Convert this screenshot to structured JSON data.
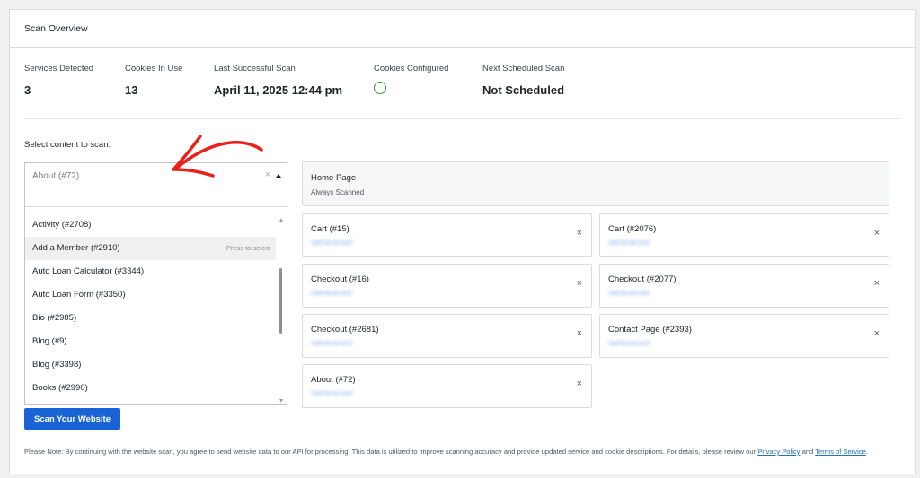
{
  "panel": {
    "title": "Scan Overview"
  },
  "stats": [
    {
      "label": "Services Detected",
      "value": "3"
    },
    {
      "label": "Cookies In Use",
      "value": "13"
    },
    {
      "label": "Last Successful Scan",
      "value": "April 11, 2025 12:44 pm"
    },
    {
      "label": "Cookies Configured",
      "icon": "check-circle-icon",
      "status_color": "#2e9e2e"
    },
    {
      "label": "Next Scheduled Scan",
      "value": "Not Scheduled"
    }
  ],
  "select": {
    "label": "Select content to scan:",
    "current_value": "About (#72)",
    "clear_symbol": "×",
    "options": [
      "Activity (#2708)",
      "Add a Member (#2910)",
      "Auto Loan Calculator (#3344)",
      "Auto Loan Form (#3350)",
      "Bio (#2985)",
      "Blog (#9)",
      "Blog (#3398)",
      "Books (#2990)"
    ],
    "highlighted_index": 1,
    "highlight_hint": "Press to select"
  },
  "annotation": {
    "icon": "red-arrow-icon",
    "color": "#e8211b"
  },
  "scan_button": {
    "label": "Scan Your Website",
    "color": "#1a63d6"
  },
  "home_page": {
    "title": "Home Page",
    "subtitle": "Always Scanned"
  },
  "pages": [
    {
      "title": "Cart (#15)",
      "url": "/adriana/cart/"
    },
    {
      "title": "Cart (#2076)",
      "url": "/adriana/cart/"
    },
    {
      "title": "Checkout (#16)",
      "url": "/adriana/cart/"
    },
    {
      "title": "Checkout (#2077)",
      "url": "/adriana/cart/"
    },
    {
      "title": "Checkout (#2681)",
      "url": "/adriana/cart/"
    },
    {
      "title": "Contact Page (#2393)",
      "url": "/adriana/cart/"
    },
    {
      "title": "About (#72)",
      "url": "/adriana/cart/"
    }
  ],
  "remove_symbol": "×",
  "note": {
    "text": "Please Note: By continuing with the website scan, you agree to send website data to our API for processing. This data is utilized to improve scanning accuracy and provide updated service and cookie descriptions. For details, please review our ",
    "privacy_link": "Privacy Policy",
    "and": " and ",
    "terms_link": "Terms of Service",
    "end": "."
  }
}
